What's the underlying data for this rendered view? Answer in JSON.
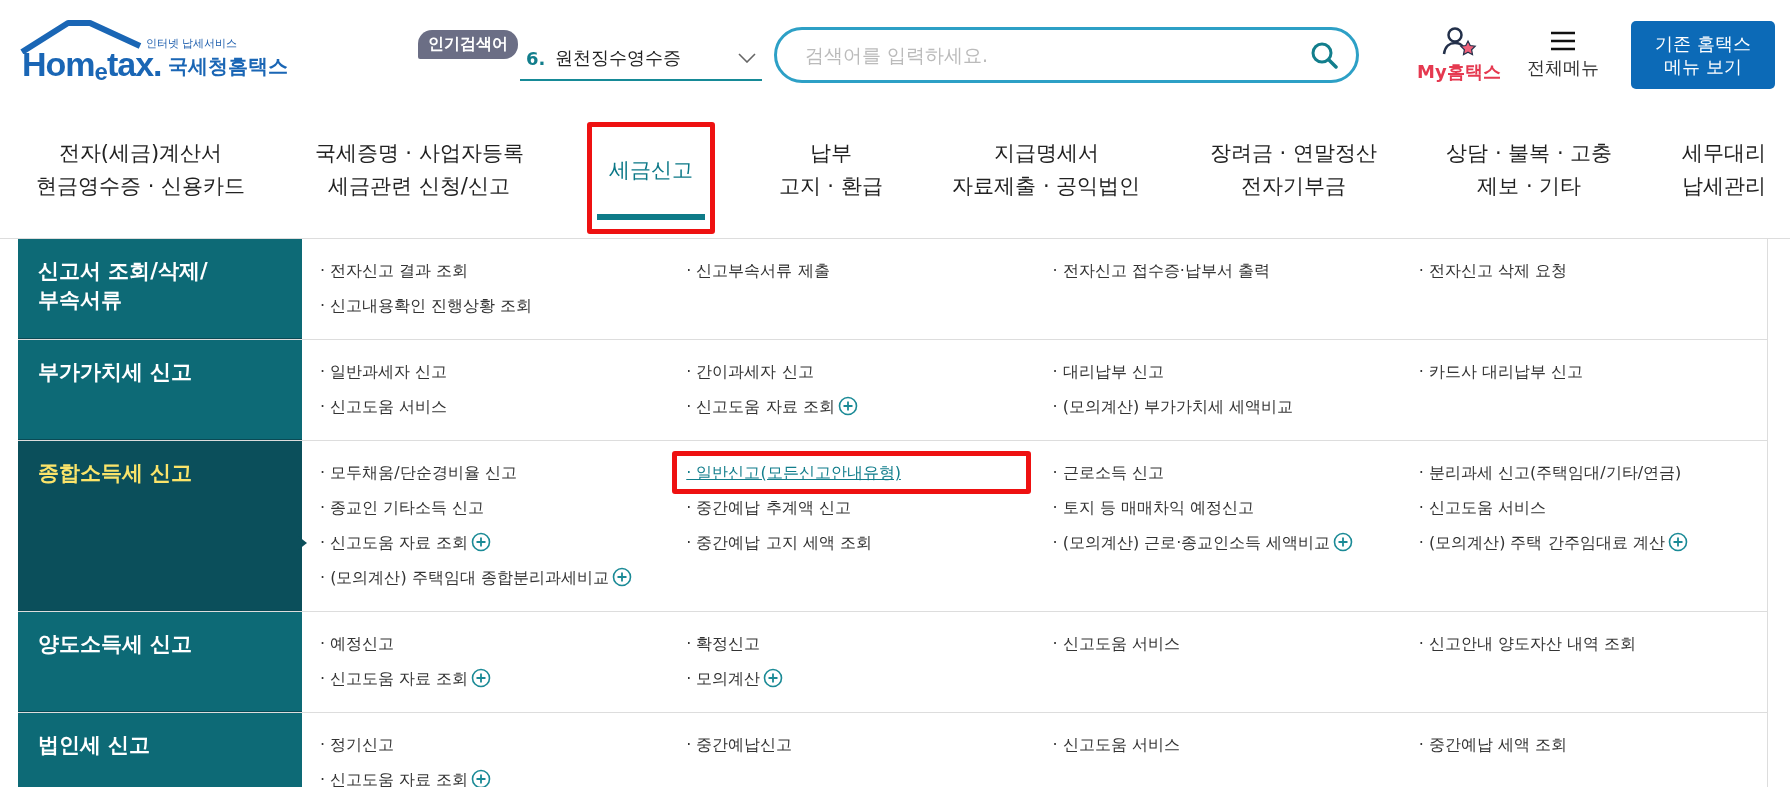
{
  "logo": {
    "tagline": "인터넷 납세서비스",
    "wordmark": "Hom$_{e}$tax.",
    "name": "국세청홈택스"
  },
  "popular": {
    "badge": "인기검색어",
    "rank": "6.",
    "keyword": "원천징수영수증"
  },
  "search": {
    "placeholder": "검색어를 입력하세요."
  },
  "utility": {
    "my": "My홈택스",
    "menu": "전체메뉴",
    "classic": "기존 홈택스 메뉴 보기"
  },
  "nav": [
    {
      "lines": [
        "전자(세금)계산서",
        "현금영수증 · 신용카드"
      ],
      "selected": false,
      "highlight": false
    },
    {
      "lines": [
        "국세증명 · 사업자등록",
        "세금관련 신청/신고"
      ],
      "selected": false,
      "highlight": false
    },
    {
      "lines": [
        "세금신고"
      ],
      "selected": true,
      "highlight": true
    },
    {
      "lines": [
        "납부",
        "고지 · 환급"
      ],
      "selected": false,
      "highlight": false
    },
    {
      "lines": [
        "지급명세서",
        "자료제출 · 공익법인"
      ],
      "selected": false,
      "highlight": false
    },
    {
      "lines": [
        "장려금 · 연말정산",
        "전자기부금"
      ],
      "selected": false,
      "highlight": false
    },
    {
      "lines": [
        "상담 · 불복 · 고충",
        "제보 · 기타"
      ],
      "selected": false,
      "highlight": false
    },
    {
      "lines": [
        "세무대리",
        "납세관리"
      ],
      "selected": false,
      "highlight": false
    }
  ],
  "rows": [
    {
      "title": "신고서 조회/삭제/\n부속서류",
      "selected": false,
      "columns": [
        [
          {
            "text": "· 전자신고 결과 조회"
          },
          {
            "text": "· 신고내용확인 진행상황 조회"
          }
        ],
        [
          {
            "text": "· 신고부속서류 제출"
          }
        ],
        [
          {
            "text": "· 전자신고 접수증·납부서 출력"
          }
        ],
        [
          {
            "text": "· 전자신고 삭제 요청"
          }
        ]
      ]
    },
    {
      "title": "부가가치세 신고",
      "selected": false,
      "columns": [
        [
          {
            "text": "· 일반과세자 신고"
          },
          {
            "text": "· 신고도움 서비스"
          }
        ],
        [
          {
            "text": "· 간이과세자 신고"
          },
          {
            "text": "· 신고도움 자료 조회",
            "plus": true
          }
        ],
        [
          {
            "text": "· 대리납부 신고"
          },
          {
            "text": "· (모의계산) 부가가치세 세액비교"
          }
        ],
        [
          {
            "text": "· 카드사 대리납부 신고"
          }
        ]
      ]
    },
    {
      "title": "종합소득세 신고",
      "selected": true,
      "columns": [
        [
          {
            "text": "· 모두채움/단순경비율 신고"
          },
          {
            "text": "· 종교인 기타소득 신고"
          },
          {
            "text": "· 신고도움 자료 조회",
            "plus": true,
            "pointer": true
          },
          {
            "text": "· (모의계산) 주택임대 종합분리과세비교",
            "plus": true
          }
        ],
        [
          {
            "text": "· 일반신고(모든신고안내유형)",
            "link": true,
            "highlight": true
          },
          {
            "text": "· 중간예납 추계액 신고"
          },
          {
            "text": "· 중간예납 고지 세액 조회"
          }
        ],
        [
          {
            "text": "· 근로소득 신고"
          },
          {
            "text": "· 토지 등 매매차익 예정신고"
          },
          {
            "text": "· (모의계산) 근로·종교인소득 세액비교",
            "plus": true
          }
        ],
        [
          {
            "text": "· 분리과세 신고(주택임대/기타/연금)"
          },
          {
            "text": "· 신고도움 서비스"
          },
          {
            "text": "· (모의계산) 주택 간주임대료 계산",
            "plus": true
          }
        ]
      ]
    },
    {
      "title": "양도소득세 신고",
      "selected": false,
      "columns": [
        [
          {
            "text": "· 예정신고"
          },
          {
            "text": "· 신고도움 자료 조회",
            "plus": true
          }
        ],
        [
          {
            "text": "· 확정신고"
          },
          {
            "text": "· 모의계산",
            "plus": true
          }
        ],
        [
          {
            "text": "· 신고도움 서비스"
          }
        ],
        [
          {
            "text": "· 신고안내 양도자산 내역 조회"
          }
        ]
      ]
    },
    {
      "title": "법인세 신고",
      "selected": false,
      "columns": [
        [
          {
            "text": "· 정기신고"
          },
          {
            "text": "· 신고도움 자료 조회",
            "plus": true
          }
        ],
        [
          {
            "text": "· 중간예납신고"
          }
        ],
        [
          {
            "text": "· 신고도움 서비스"
          }
        ],
        [
          {
            "text": "· 중간예납 세액 조회"
          }
        ]
      ]
    }
  ]
}
